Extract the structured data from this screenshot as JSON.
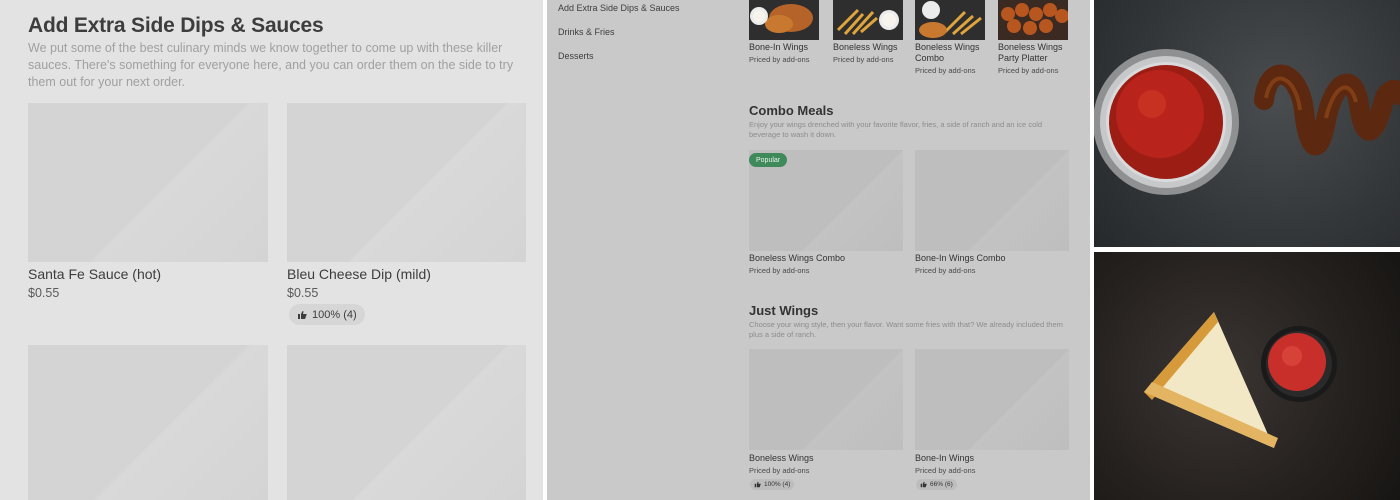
{
  "panel1": {
    "title": "Add Extra Side Dips & Sauces",
    "description": "We put some of the best culinary minds we know together to come up with these killer sauces. There's something for everyone here, and you can order them on the side to try them out for your next order.",
    "items": [
      {
        "name": "Santa Fe Sauce (hot)",
        "price": "$0.55"
      },
      {
        "name": "Bleu Cheese Dip (mild)",
        "price": "$0.55",
        "rating": "100% (4)"
      }
    ]
  },
  "panel2": {
    "nav": [
      "Add Extra Side Dips & Sauces",
      "Drinks & Fries",
      "Desserts"
    ],
    "top_items": [
      {
        "name": "Bone-In Wings",
        "price": "Priced by add-ons"
      },
      {
        "name": "Boneless Wings",
        "price": "Priced by add-ons"
      },
      {
        "name": "Boneless Wings Combo",
        "price": "Priced by add-ons"
      },
      {
        "name": "Boneless Wings Party Platter",
        "price": "Priced by add-ons"
      }
    ],
    "combo": {
      "title": "Combo Meals",
      "description": "Enjoy your wings drenched with your favorite flavor, fries, a side of ranch and an ice cold beverage to wash it down.",
      "badge": "Popular",
      "items": [
        {
          "name": "Boneless Wings Combo",
          "price": "Priced by add-ons"
        },
        {
          "name": "Bone-In Wings Combo",
          "price": "Priced by add-ons"
        }
      ]
    },
    "just_wings": {
      "title": "Just Wings",
      "description": "Choose your wing style, then your flavor. Want some fries with that? We already included them plus a side of ranch.",
      "items": [
        {
          "name": "Boneless Wings",
          "price": "Priced by add-ons",
          "rating": "100% (4)"
        },
        {
          "name": "Bone-In Wings",
          "price": "Priced by add-ons",
          "rating": "66% (6)"
        }
      ]
    }
  },
  "colors": {
    "panel1_bg": "#e3e3e3",
    "panel2_bg": "#c9c9c9",
    "popular_badge": "#3f8a5a",
    "sauce_red": "#b8241c",
    "glaze_brown": "#5c2810"
  },
  "icons": [
    "thumbs-up-icon"
  ]
}
